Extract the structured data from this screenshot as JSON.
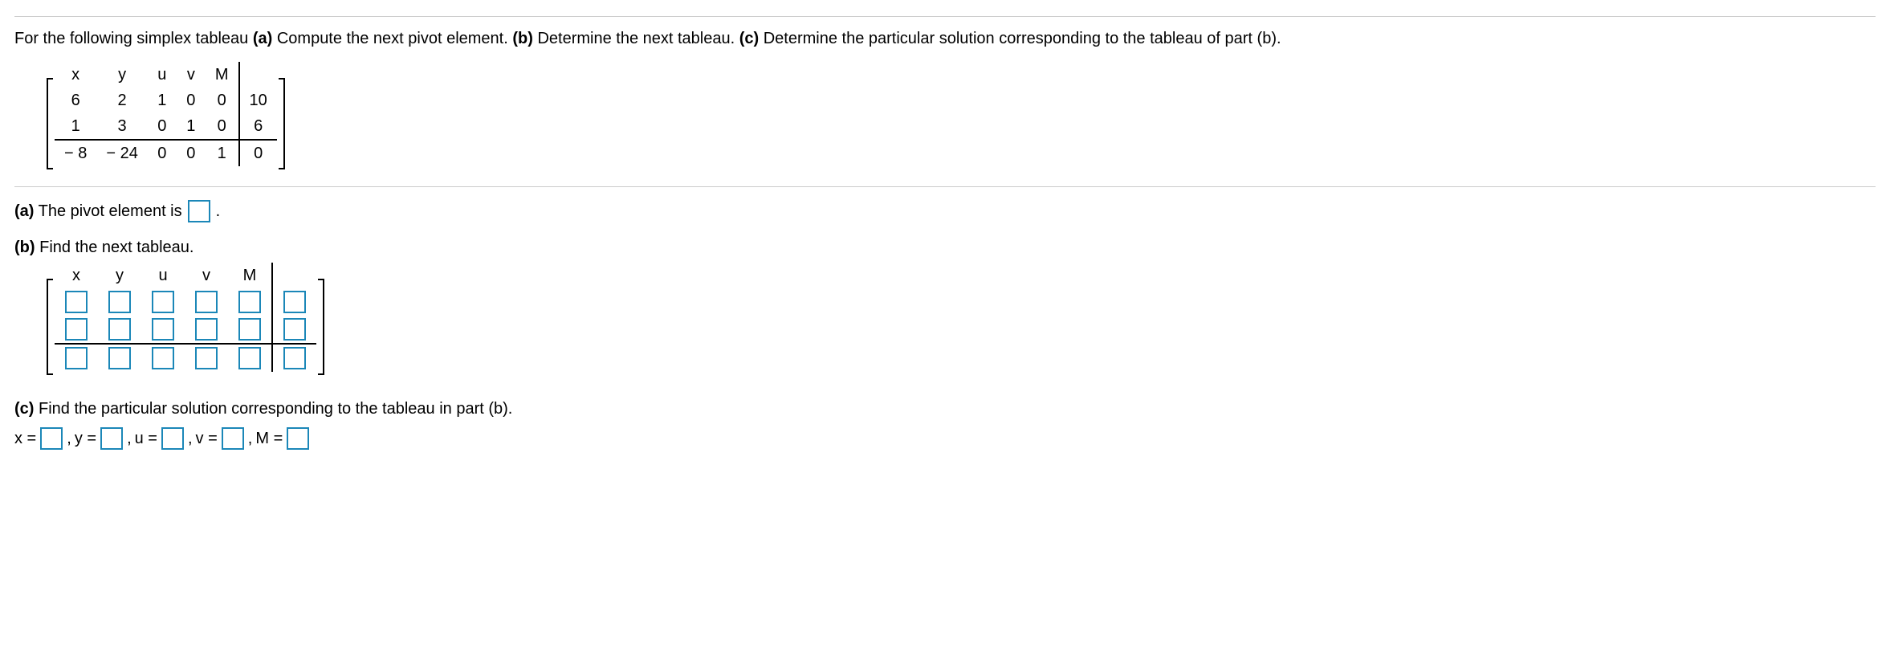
{
  "intro": {
    "lead": "For the following simplex tableau ",
    "a_bold": "(a)",
    "a_text": " Compute the next pivot element. ",
    "b_bold": "(b)",
    "b_text": " Determine the next tableau. ",
    "c_bold": "(c)",
    "c_text": " Determine the particular solution corresponding to the tableau of part (b)."
  },
  "headers": {
    "x": "x",
    "y": "y",
    "u": "u",
    "v": "v",
    "M": "M"
  },
  "tableau": {
    "r1": {
      "x": "6",
      "y": "2",
      "u": "1",
      "v": "0",
      "M": "0",
      "rhs": "10"
    },
    "r2": {
      "x": "1",
      "y": "3",
      "u": "0",
      "v": "1",
      "M": "0",
      "rhs": "6"
    },
    "r3": {
      "x": "− 8",
      "y": "− 24",
      "u": "0",
      "v": "0",
      "M": "1",
      "rhs": "0"
    }
  },
  "partA": {
    "label_bold": "(a)",
    "text1": " The pivot element is ",
    "period": "."
  },
  "partB": {
    "label_bold": "(b)",
    "text1": " Find the next tableau."
  },
  "partC": {
    "label_bold": "(c)",
    "text1": " Find the particular solution corresponding to the tableau in part (b).",
    "xlbl": "x = ",
    "ylbl": "y = ",
    "ulbl": "u = ",
    "vlbl": "v = ",
    "Mlbl": "M = ",
    "comma": ", "
  }
}
